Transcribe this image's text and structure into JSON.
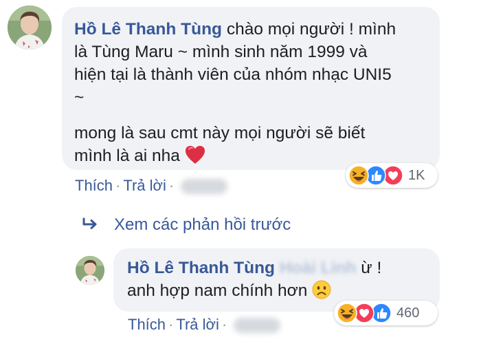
{
  "comments": [
    {
      "author": "Hồ Lê Thanh Tùng",
      "text_parts": {
        "line1": "chào mọi người ! mình",
        "line2": "là Tùng Maru ~ mình sinh năm 1999 và",
        "line3": "hiện tại là thành viên của nhóm nhạc UNI5",
        "line4": "~",
        "line5": "mong là sau cmt này mọi người sẽ biết",
        "line6": "mình là ai nha"
      },
      "emoji": "red-heart",
      "actions": {
        "like": "Thích",
        "reply": "Trả lời",
        "separator": "·"
      },
      "reactions": {
        "icons": [
          "haha",
          "like",
          "love"
        ],
        "count": "1K"
      }
    },
    {
      "author": "Hồ Lê Thanh Tùng",
      "mention": "Hoài Linh",
      "text_parts": {
        "line1": "ừ !",
        "line2": "anh hợp nam chính hơn"
      },
      "emoji": "frowning-face",
      "actions": {
        "like": "Thích",
        "reply": "Trả lời",
        "separator": "·"
      },
      "reactions": {
        "icons": [
          "haha",
          "love",
          "like"
        ],
        "count": "460"
      }
    }
  ],
  "view_previous": "Xem các phản hồi trước",
  "colors": {
    "bubble_bg": "#f0f2f5",
    "link_blue": "#385898",
    "text": "#1c1e21",
    "like_blue": "#2d88ff",
    "love_red": "#f33e58",
    "haha_yellow": "#f7b125"
  }
}
